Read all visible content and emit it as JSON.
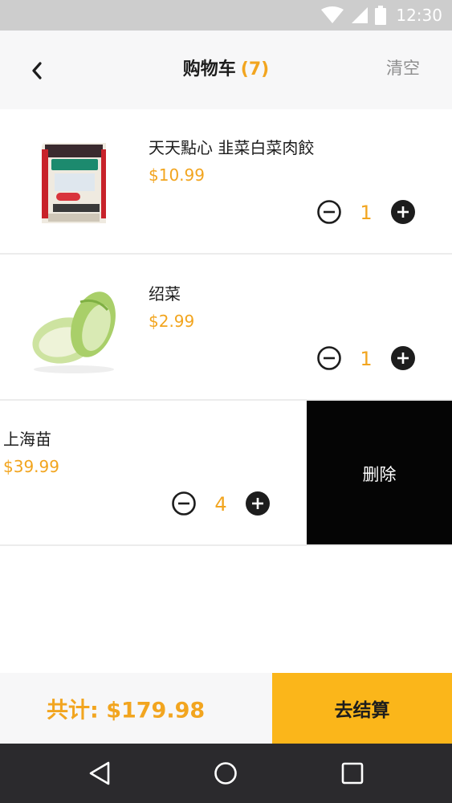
{
  "status_bar": {
    "time": "12:30",
    "icons": [
      "wifi-icon",
      "signal-icon",
      "battery-icon"
    ]
  },
  "header": {
    "back_icon": "chevron-left-icon",
    "title": "购物车",
    "count": "(7)",
    "clear_label": "清空"
  },
  "items": [
    {
      "name": "天天點心 韭菜白菜肉餃",
      "price": "$10.99",
      "quantity": "1",
      "image": "dumpling-package"
    },
    {
      "name": "绍菜",
      "price": "$2.99",
      "quantity": "1",
      "image": "napa-cabbage"
    },
    {
      "name": "上海苗",
      "price": "$39.99",
      "quantity": "4",
      "delete_label": "删除"
    }
  ],
  "footer": {
    "total_label": "共计: $179.98",
    "checkout_label": "去结算"
  },
  "nav": [
    "back-triangle-icon",
    "home-circle-icon",
    "recents-square-icon"
  ],
  "colors": {
    "accent": "#f2a51f",
    "checkout": "#fbb61a",
    "delete": "#050505",
    "nav": "#2b2a2d"
  }
}
